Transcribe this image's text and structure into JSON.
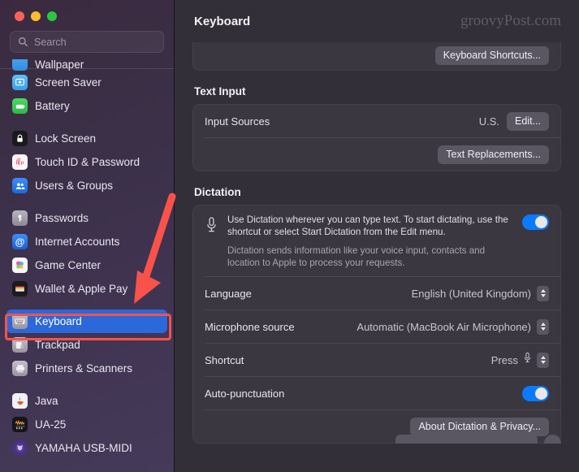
{
  "window": {
    "traffic_lights": [
      "close",
      "minimize",
      "zoom"
    ],
    "colors": {
      "accent_blue": "#0a7aff",
      "selected_blue": "#2b68d9",
      "annotation_red": "#f9524b",
      "panel_bg": "#322f38",
      "card_bg": "#3a3741"
    }
  },
  "sidebar": {
    "search": {
      "placeholder": "Search",
      "icon": "search-icon"
    },
    "items": [
      {
        "label": "Wallpaper",
        "icon": "wallpaper-icon",
        "clipped": true
      },
      {
        "label": "Screen Saver",
        "icon": "screen-saver-icon"
      },
      {
        "label": "Battery",
        "icon": "battery-icon"
      },
      {
        "label": "Lock Screen",
        "icon": "lock-screen-icon",
        "group_start": true
      },
      {
        "label": "Touch ID & Password",
        "icon": "touch-id-icon"
      },
      {
        "label": "Users & Groups",
        "icon": "users-groups-icon"
      },
      {
        "label": "Passwords",
        "icon": "passwords-icon",
        "group_start": true
      },
      {
        "label": "Internet Accounts",
        "icon": "internet-accounts-icon"
      },
      {
        "label": "Game Center",
        "icon": "game-center-icon"
      },
      {
        "label": "Wallet & Apple Pay",
        "icon": "wallet-icon"
      },
      {
        "label": "Keyboard",
        "icon": "keyboard-icon",
        "selected": true,
        "group_start": true
      },
      {
        "label": "Trackpad",
        "icon": "trackpad-icon"
      },
      {
        "label": "Printers & Scanners",
        "icon": "printers-scanners-icon"
      },
      {
        "label": "Java",
        "icon": "java-icon",
        "group_start": true
      },
      {
        "label": "UA-25",
        "icon": "ua25-icon"
      },
      {
        "label": "YAMAHA USB-MIDI",
        "icon": "yamaha-usb-midi-icon"
      }
    ]
  },
  "header": {
    "title": "Keyboard",
    "watermark": "groovyPost.com"
  },
  "main": {
    "keyboard_shortcuts_button": "Keyboard Shortcuts...",
    "text_input": {
      "section_title": "Text Input",
      "input_sources_label": "Input Sources",
      "input_sources_value": "U.S.",
      "edit_button": "Edit...",
      "text_replacements_button": "Text Replacements..."
    },
    "dictation": {
      "section_title": "Dictation",
      "mic_icon": "microphone-icon",
      "description_primary": "Use Dictation wherever you can type text. To start dictating, use the shortcut or select Start Dictation from the Edit menu.",
      "description_secondary": "Dictation sends information like your voice input, contacts and location to Apple to process your requests.",
      "enabled_toggle": "on",
      "rows": [
        {
          "label": "Language",
          "value": "English (United Kingdom)",
          "control": "popup-menu"
        },
        {
          "label": "Microphone source",
          "value": "Automatic (MacBook Air Microphone)",
          "control": "popup-menu"
        },
        {
          "label": "Shortcut",
          "value": "Press",
          "control": "popup-menu",
          "glyph": "microphone-icon"
        }
      ],
      "auto_punctuation_label": "Auto-punctuation",
      "auto_punctuation_toggle": "on",
      "about_button": "About Dictation & Privacy..."
    }
  },
  "annotations": {
    "arrow": "red-down-arrow",
    "highlight_box": "red-rectangle-around-keyboard"
  }
}
